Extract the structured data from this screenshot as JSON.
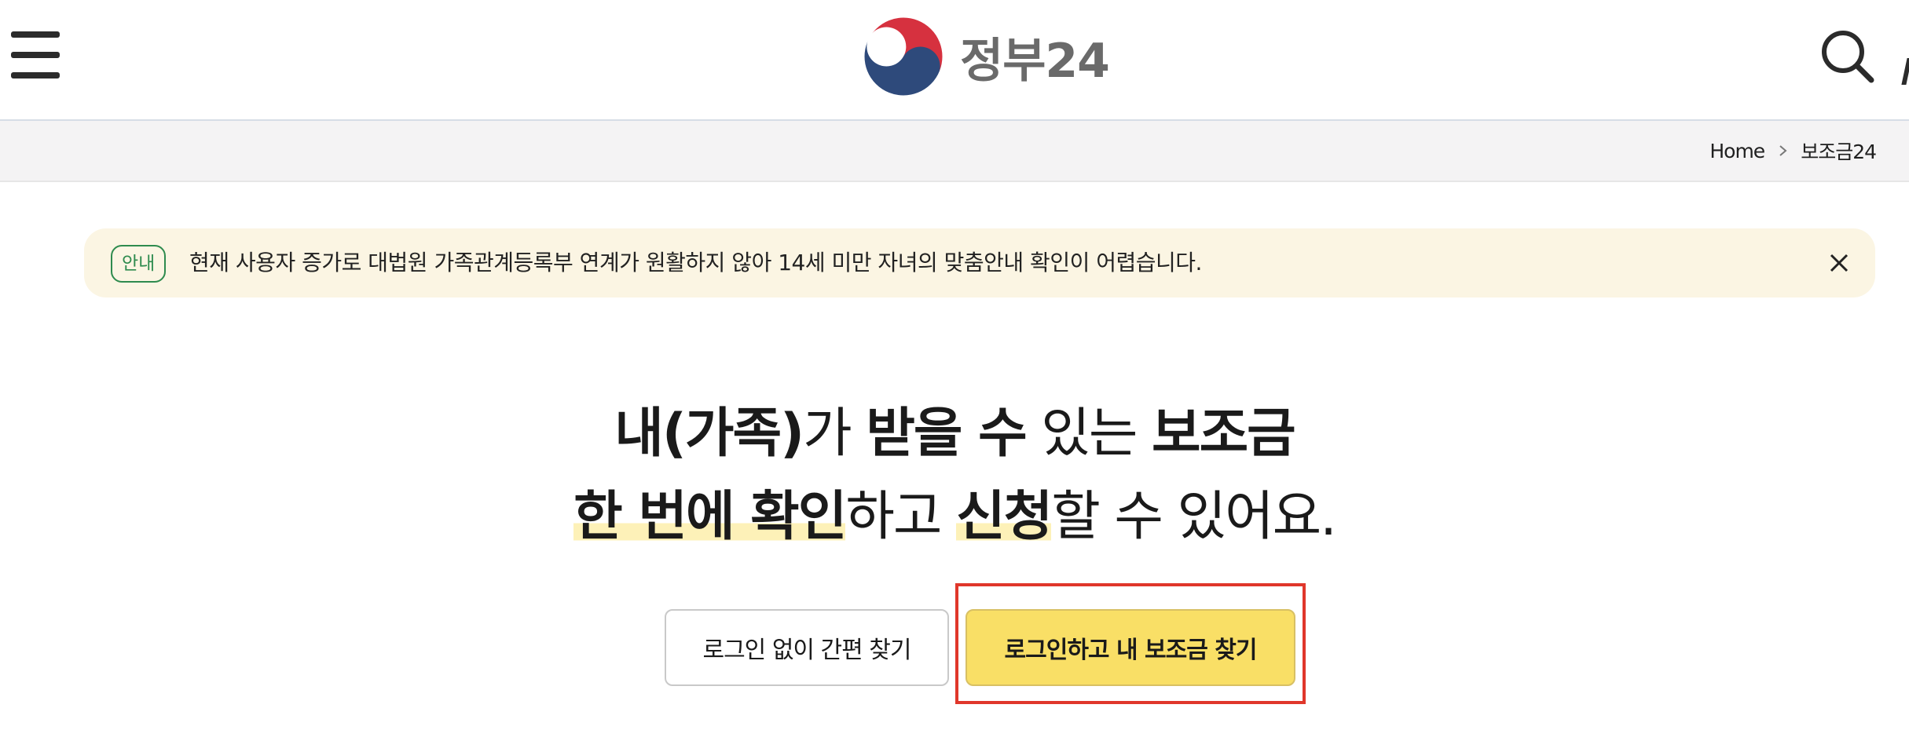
{
  "header": {
    "logo_text": "정부24",
    "menu_icon": "hamburger-menu-icon",
    "search_icon": "search-icon"
  },
  "breadcrumb": {
    "home": "Home",
    "current": "보조금24"
  },
  "notice": {
    "badge": "안내",
    "text": "현재 사용자 증가로 대법원 가족관계등록부 연계가 원활하지 않아 14세 미만 자녀의 맞춤안내 확인이 어렵습니다.",
    "close_icon": "close-icon"
  },
  "headline": {
    "line1": {
      "part1": "내(가족)",
      "part2": "가 ",
      "part3": "받을 수",
      "part4": " 있는 ",
      "part5": "보조금"
    },
    "line2": {
      "part1": "한 번에 확인",
      "part2": "하고 ",
      "part3": "신청",
      "part4": "할 수 있어요."
    }
  },
  "buttons": {
    "guest_search": "로그인 없이 간편 찾기",
    "login_search": "로그인하고 내 보조금 찾기"
  },
  "colors": {
    "primary_button": "#f9df66",
    "notice_bg": "#fbf5e3",
    "badge": "#2e8b4e",
    "highlight_box": "#e0372b"
  }
}
